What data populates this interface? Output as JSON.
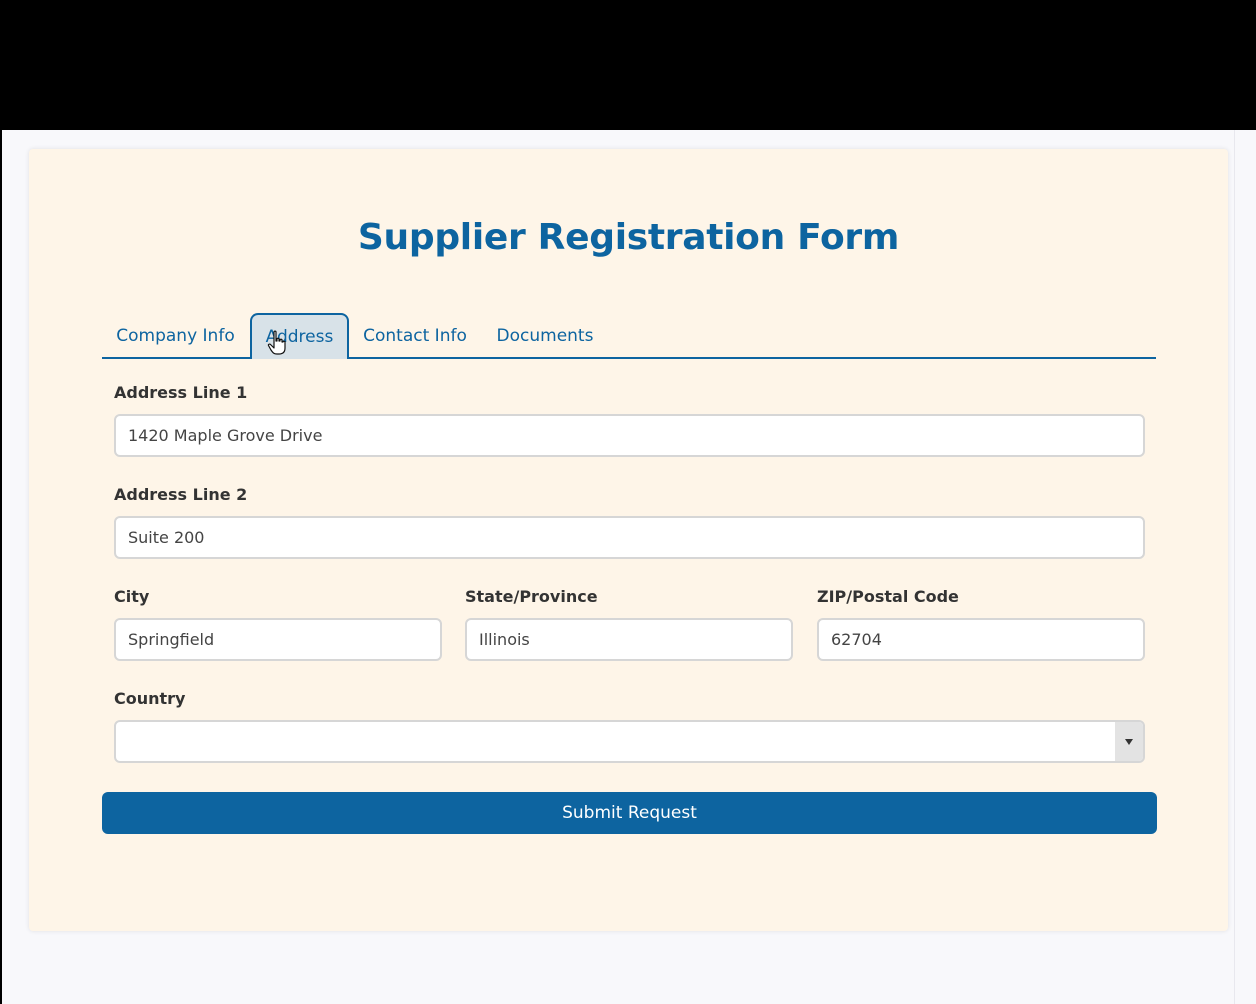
{
  "form": {
    "title": "Supplier Registration Form",
    "tabs": [
      {
        "label": "Company Info",
        "active": false
      },
      {
        "label": "Address",
        "active": true
      },
      {
        "label": "Contact Info",
        "active": false
      },
      {
        "label": "Documents",
        "active": false
      }
    ],
    "fields": {
      "address_line_1": {
        "label": "Address Line 1",
        "value": "1420 Maple Grove Drive"
      },
      "address_line_2": {
        "label": "Address Line 2",
        "value": "Suite 200"
      },
      "city": {
        "label": "City",
        "value": "Springfield"
      },
      "state": {
        "label": "State/Province",
        "value": "Illinois"
      },
      "zip": {
        "label": "ZIP/Postal Code",
        "value": "62704"
      },
      "country": {
        "label": "Country",
        "value": ""
      }
    },
    "submit_label": "Submit Request"
  },
  "colors": {
    "accent": "#0d64a0",
    "card_background": "#fef5e8",
    "active_tab_background": "#d8e2e8"
  },
  "icons": {
    "cursor": "hand-pointer-icon",
    "select_arrow": "caret-down-icon"
  }
}
